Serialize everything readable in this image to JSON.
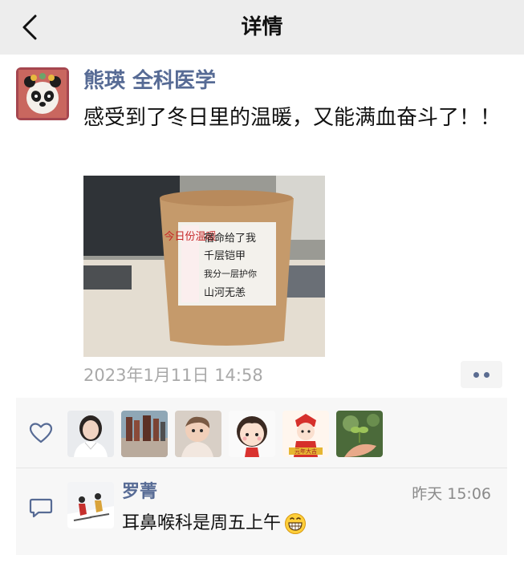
{
  "nav": {
    "title": "详情",
    "back_icon": "chevron-left-icon"
  },
  "post": {
    "author": "熊瑛 全科医学",
    "text": "感受到了冬日里的温暖，又能满血奋斗了！！",
    "timestamp": "2023年1月11日 14:58",
    "more_icon": "more-dots-icon",
    "photo": {
      "label_red": "今日份温暖",
      "label_lines": [
        "宿命给了我",
        "千层铠甲",
        "我分一层护你",
        "山河无恙"
      ]
    }
  },
  "likes": {
    "icon": "heart-icon",
    "avatars": [
      "avatar-woman",
      "avatar-plaza",
      "avatar-baby",
      "avatar-cartoon-girl",
      "avatar-cartoon-festival",
      "avatar-plant"
    ],
    "festival_text": "元年大吉"
  },
  "comment": {
    "icon": "comment-icon",
    "name": "罗菁",
    "time": "昨天 15:06",
    "text": "耳鼻喉科是周五上午",
    "emoji": "grin-emoji"
  },
  "colors": {
    "link": "#576b95",
    "nav_bg": "#ededed",
    "panel_bg": "#f7f7f7",
    "muted": "#a9a9a9"
  }
}
